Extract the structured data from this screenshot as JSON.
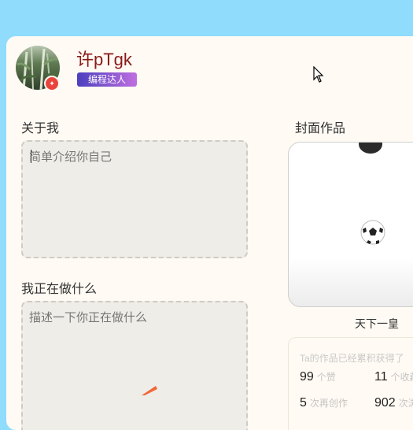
{
  "profile": {
    "username": "许pTgk",
    "role_badge": "编程达人"
  },
  "about": {
    "title": "关于我",
    "placeholder": "简单介绍你自己"
  },
  "doing": {
    "title": "我正在做什么",
    "placeholder": "描述一下你正在做什么"
  },
  "cover": {
    "title": "封面作品",
    "caption": "天下一皇"
  },
  "stats": {
    "title": "Ta的作品已经累积获得了",
    "items": [
      {
        "value": "99",
        "label": "个赞"
      },
      {
        "value": "11",
        "label": "个收藏"
      },
      {
        "value": "5",
        "label": "次再创作"
      },
      {
        "value": "902",
        "label": "次浏览"
      }
    ]
  },
  "colors": {
    "background": "#8fdcfc",
    "card": "#fffaf3",
    "username": "#8b1a1a",
    "badge_gradient_start": "#4b3fbf",
    "badge_gradient_end": "#c06ee0"
  }
}
